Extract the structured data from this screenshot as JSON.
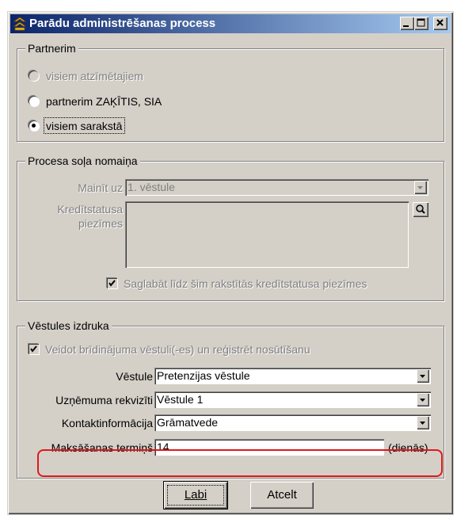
{
  "window": {
    "title": "Parādu administrēšanas process",
    "minimize_icon": "minimize-icon",
    "maximize_icon": "maximize-icon",
    "close_icon": "close-icon"
  },
  "partner_group": {
    "legend": "Partnerim",
    "options": [
      {
        "label": "visiem atzīmētajiem",
        "selected": false,
        "enabled": false
      },
      {
        "label": "partnerim ZAĶĪTIS, SIA",
        "selected": false,
        "enabled": true
      },
      {
        "label": "visiem sarakstā",
        "selected": true,
        "enabled": true
      }
    ]
  },
  "process_group": {
    "legend": "Procesa soļa nomaiņa",
    "change_to_label": "Mainīt uz",
    "change_to_value": "1. vēstule",
    "notes_label_line1": "Kredītstatusa",
    "notes_label_line2": "piezīmes",
    "notes_value": "",
    "save_notes_label": "Saglabāt līdz šim rakstītās kredītstatusa piezīmes",
    "save_notes_checked": true
  },
  "letter_group": {
    "legend": "Vēstules izdruka",
    "create_warning_label": "Veidot brīdinājuma vēstuli(-es) un reģistrēt nosūtīšanu",
    "create_warning_checked": true,
    "letter_label": "Vēstule",
    "letter_value": "Pretenzijas vēstule",
    "requisites_label": "Uzņēmuma rekvizīti",
    "requisites_value": "Vēstule 1",
    "contact_label": "Kontaktinformācija",
    "contact_value": "Grāmatvede",
    "payment_term_label": "Maksāšanas termiņš",
    "payment_term_value": "14",
    "payment_term_unit": "(dienās)"
  },
  "buttons": {
    "ok_label": "Labi",
    "cancel_label": "Atcelt"
  },
  "colors": {
    "title_start": "#0a246a",
    "title_end": "#a6caf0",
    "highlight": "#e01818",
    "face": "#d4d0c8"
  }
}
